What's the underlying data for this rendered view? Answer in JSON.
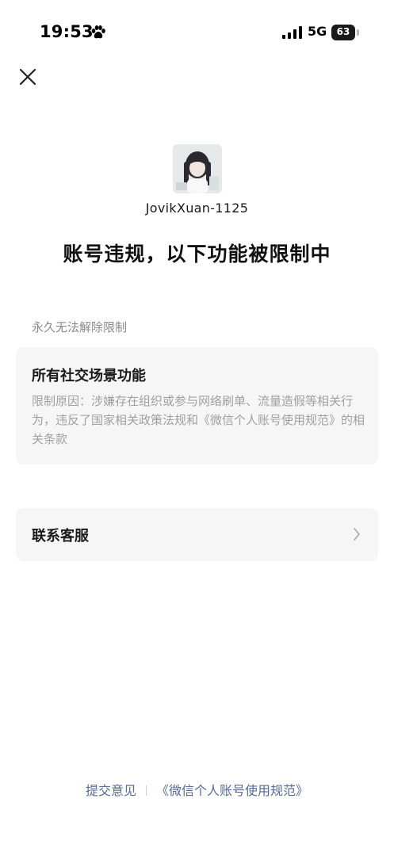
{
  "status_bar": {
    "time": "19:53",
    "network": "5G",
    "battery_level": "63",
    "icons": [
      "paw-icon",
      "signal-bars-icon",
      "battery-icon"
    ]
  },
  "profile": {
    "username": "JovikXuan-1125"
  },
  "headline": "账号违规，以下功能被限制中",
  "restriction": {
    "section_label": "永久无法解除限制",
    "title": "所有社交场景功能",
    "reason": "限制原因：涉嫌存在组织或参与网络刷单、流量造假等相关行为，违反了国家相关政策法规和《微信个人账号使用规范》的相关条款"
  },
  "contact": {
    "label": "联系客服"
  },
  "footer": {
    "feedback_link": "提交意见",
    "policy_link": "《微信个人账号使用规范》"
  },
  "colors": {
    "link": "#576b95",
    "card_background": "#f6f6f6",
    "muted_text": "#8a8a8a"
  }
}
